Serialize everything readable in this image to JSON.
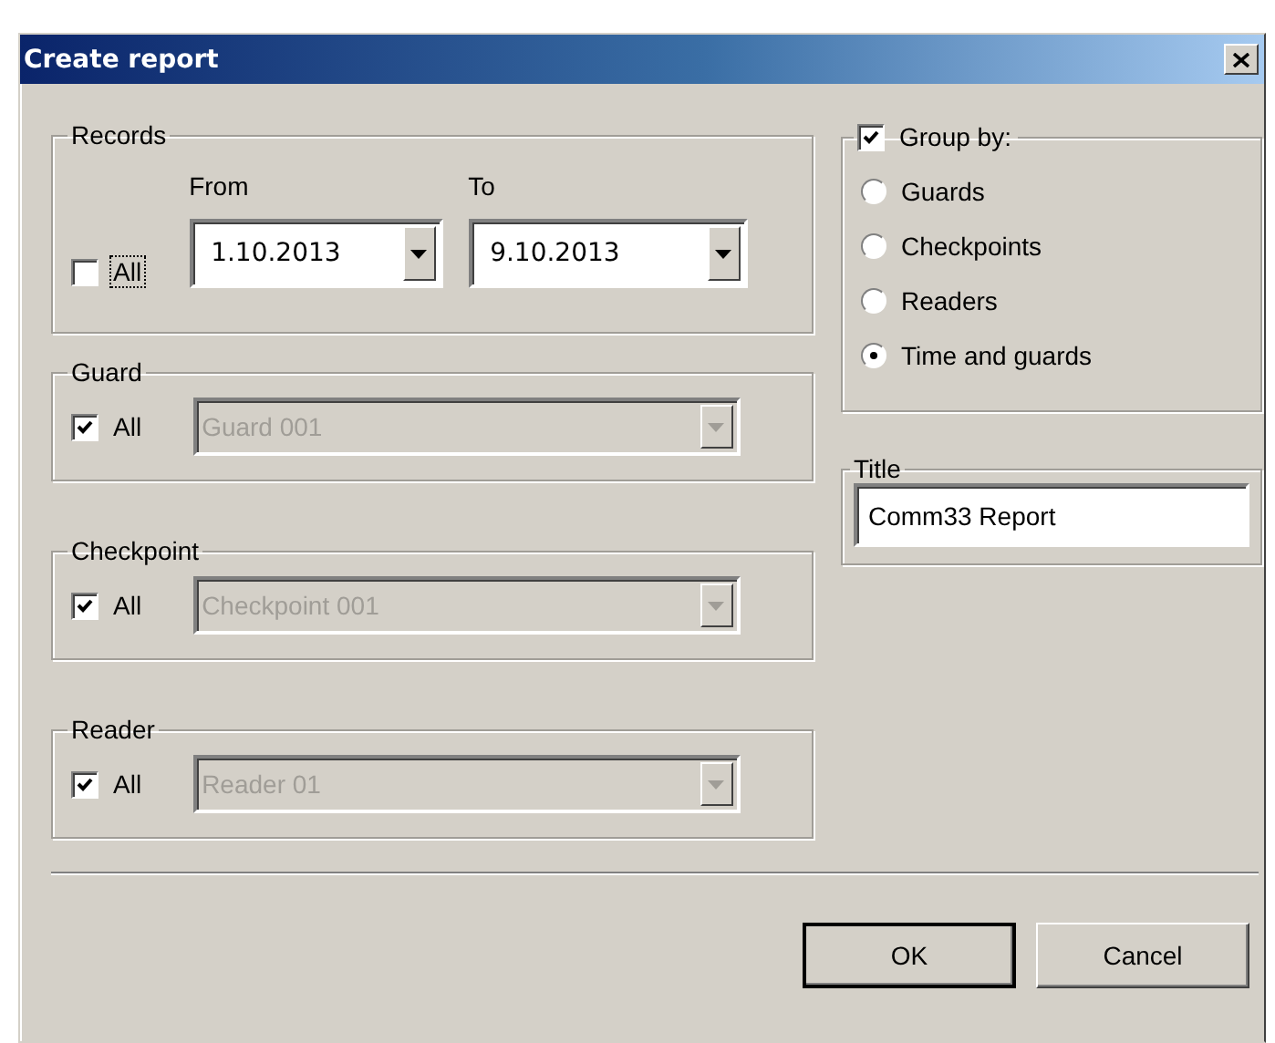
{
  "window": {
    "title": "Create report"
  },
  "records": {
    "legend": "Records",
    "all": {
      "label": "All",
      "checked": false,
      "focused": true
    },
    "from": {
      "label": "From",
      "value": "1.10.2013"
    },
    "to": {
      "label": "To",
      "value": "9.10.2013"
    }
  },
  "filters": [
    {
      "legend": "Guard",
      "all_label": "All",
      "checked": true,
      "value": "Guard 001",
      "disabled": true
    },
    {
      "legend": "Checkpoint",
      "all_label": "All",
      "checked": true,
      "value": "Checkpoint 001",
      "disabled": true
    },
    {
      "legend": "Reader",
      "all_label": "All",
      "checked": true,
      "value": "Reader 01",
      "disabled": true
    }
  ],
  "group_by": {
    "label": "Group by:",
    "checked": true,
    "options": [
      {
        "label": "Guards",
        "selected": false
      },
      {
        "label": "Checkpoints",
        "selected": false
      },
      {
        "label": "Readers",
        "selected": false
      },
      {
        "label": "Time and guards",
        "selected": true
      }
    ]
  },
  "title_field": {
    "legend": "Title",
    "value": "Comm33 Report"
  },
  "buttons": [
    {
      "label": "OK",
      "default": true
    },
    {
      "label": "Cancel",
      "default": false
    }
  ]
}
